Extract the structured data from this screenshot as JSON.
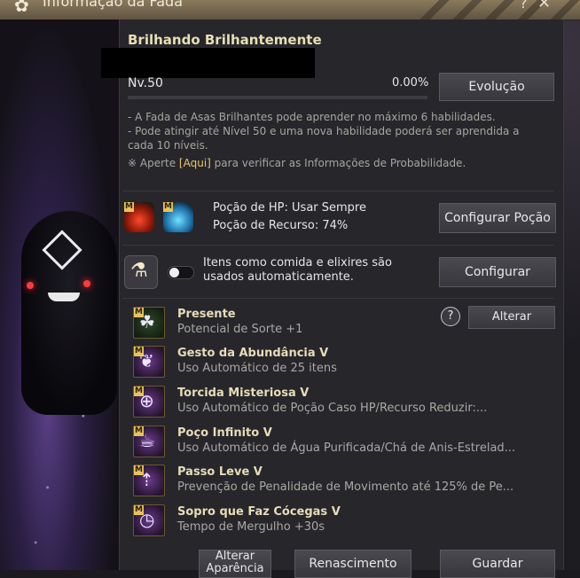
{
  "window": {
    "title": "Informação da Fada",
    "help_glyph": "?",
    "close_glyph": "✕"
  },
  "fairy": {
    "name": "Brilhando Brilhantemente",
    "level": "Nv.50",
    "exp_percent": "0.00%",
    "evolution_button": "Evolução"
  },
  "info": {
    "line1": "- A Fada de Asas Brilhantes pode aprender no máximo 6 habilidades.",
    "line2": "- Pode atingir até Nível 50 e uma nova habilidade poderá ser aprendida a",
    "line3": "cada 10 níveis.",
    "note_prefix": "※ Aperte ",
    "note_link": "[Aqui]",
    "note_suffix": " para verificar as Informações de Probabilidade."
  },
  "potions": {
    "badge": "M",
    "hp_text": "Poção de HP: Usar Sempre",
    "mp_text": "Poção de Recurso: 74%",
    "configure_button": "Configurar Poção"
  },
  "food": {
    "text": "Itens como comida e elixires são usados automaticamente.",
    "toggle_on": false,
    "configure_button": "Configurar"
  },
  "skills": {
    "alter_button": "Alterar",
    "help_glyph": "?",
    "badge": "M",
    "items": [
      {
        "name": "Presente",
        "desc": "Potencial de Sorte +1",
        "icon": "clover-icon"
      },
      {
        "name": "Gesto da Abundância V",
        "desc": "Uso Automático de 25 itens",
        "icon": "fairy-icon"
      },
      {
        "name": "Torcida Misteriosa V",
        "desc": "Uso Automático de Poção Caso HP/Recurso Reduzir:...",
        "icon": "potion-plus-icon"
      },
      {
        "name": "Poço Infinito V",
        "desc": "Uso Automático de Água Purificada/Chá de Anis-Estrelad...",
        "icon": "cup-icon"
      },
      {
        "name": "Passo Leve V",
        "desc": "Prevenção de Penalidade de Movimento até 125% de Pe...",
        "icon": "weight-up-icon"
      },
      {
        "name": "Sopro que Faz Cócegas V",
        "desc": "Tempo de Mergulho +30s",
        "icon": "timer-icon"
      }
    ]
  },
  "bottom": {
    "appearance_button_l1": "Alterar",
    "appearance_button_l2": "Aparência",
    "rebirth_button": "Renascimento",
    "save_button": "Guardar"
  },
  "colors": {
    "accent_gold": "#e8c76a",
    "panel_bg": "#27262b",
    "title_bar": "#8a7a5c"
  }
}
